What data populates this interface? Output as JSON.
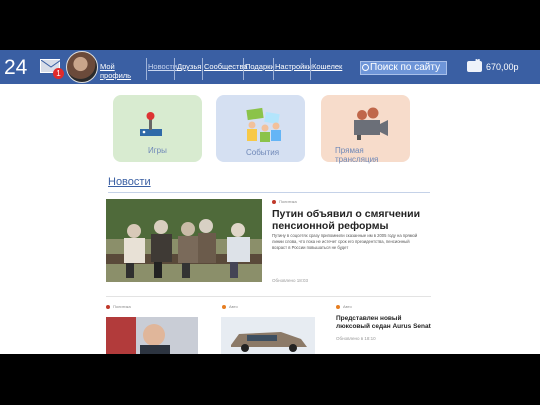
{
  "header": {
    "counter": "24",
    "mail_badge": "1",
    "nav": [
      {
        "label": "Мой профиль"
      },
      {
        "label": "Новости"
      },
      {
        "label": "Друзья"
      },
      {
        "label": "Сообщества"
      },
      {
        "label": "Подарки"
      },
      {
        "label": "Настройки"
      },
      {
        "label": "Кошелек"
      }
    ],
    "search_placeholder": "Поиск по сайту",
    "balance": "670,00р"
  },
  "tiles": [
    {
      "label": "Игры"
    },
    {
      "label": "События"
    },
    {
      "label": "Прямая трансляция"
    }
  ],
  "section_title": "Новости",
  "main_story": {
    "category": "Политика",
    "headline": "Путин объявил о смягчении пенсионной реформы",
    "lead": "Путину в соцсетях сразу припомнили сказанные им в 2005 году на прямой линии слова, что пока не истечет срок его президентства, пенсионный возраст в России повышаться не будет",
    "time": "Обновлено 18:03"
  },
  "sub_stories": [
    {
      "category": "Политика"
    },
    {
      "category": "Авто"
    },
    {
      "category": "Авто",
      "headline": "Представлен новый люксовый седан Aurus Senat",
      "time": "Обновлено в 18:10"
    }
  ],
  "colors": {
    "header": "#3a5fa3",
    "accent_dot": "#c0392b",
    "auto_dot": "#e67e22"
  }
}
